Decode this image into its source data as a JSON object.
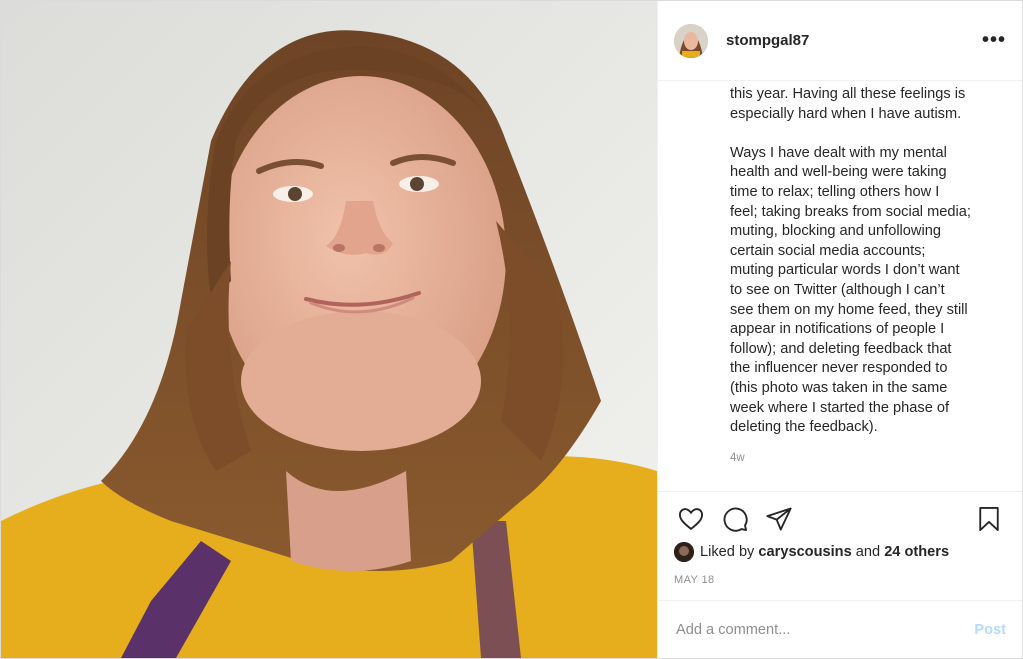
{
  "post": {
    "username": "stompgal87",
    "more_icon": "more-horizontal-icon",
    "caption": "this year. Having all these feelings is\nespecially hard when I have autism.\n\nWays I have dealt with my mental\nhealth and well-being were taking\ntime to relax; telling others how I\nfeel; taking breaks from social media;\nmuting, blocking and unfollowing\ncertain social media accounts;\nmuting particular words I don’t want\nto see on Twitter (although I can’t\nsee them on my home feed, they still\nappear in notifications of people I\nfollow); and deleting feedback that\nthe influencer never responded to\n(this photo was taken in the same\nweek where I started the phase of\ndeleting the feedback).",
    "age": "4w",
    "likes_prefix": "Liked by ",
    "liked_by_user": "caryscousins",
    "likes_and": " and ",
    "likes_others": "24 others",
    "date": "MAY 18"
  },
  "actions": {
    "icons": [
      "heart-icon",
      "comment-icon",
      "share-icon",
      "bookmark-icon"
    ]
  },
  "comment": {
    "placeholder": "Add a comment...",
    "post_label": "Post"
  },
  "colors": {
    "text": "#262626",
    "muted": "#8e8e8e",
    "post_button_disabled": "#b3dbff",
    "shirt": "#e9b21e",
    "hair": "#7a4a27"
  }
}
